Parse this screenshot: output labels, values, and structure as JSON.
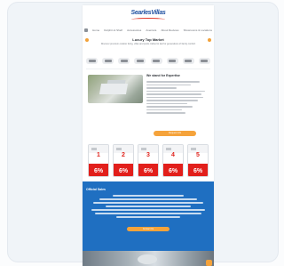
{
  "site": {
    "logo_text": "SearlesVillas"
  },
  "nav": {
    "items": [
      "Home",
      "Dolphin & Shelf",
      "Accessories",
      "Aventura",
      "About Reviews",
      "Showrooms & Locations"
    ]
  },
  "hero": {
    "title": "Luxury Top Market",
    "subtitle": "Discover premium outdoor living, villas and pools crafted to last for generations of family comfort"
  },
  "brands": [
    "brand-1",
    "brand-2",
    "brand-3",
    "brand-4",
    "brand-5",
    "brand-6",
    "brand-7",
    "brand-8"
  ],
  "feature": {
    "title": "We stand for Expertise"
  },
  "cta_primary": "Request Info",
  "offers": {
    "numbers": [
      "1",
      "2",
      "3",
      "4",
      "5"
    ],
    "percent": [
      "6%",
      "6%",
      "6%",
      "6%",
      "6%"
    ]
  },
  "blue_section": {
    "heading": "Official Sales",
    "cta": "Contact Us"
  },
  "colors": {
    "accent": "#f5a33b",
    "brand_blue": "#1f6fc1",
    "offer_red": "#e21f1b"
  }
}
